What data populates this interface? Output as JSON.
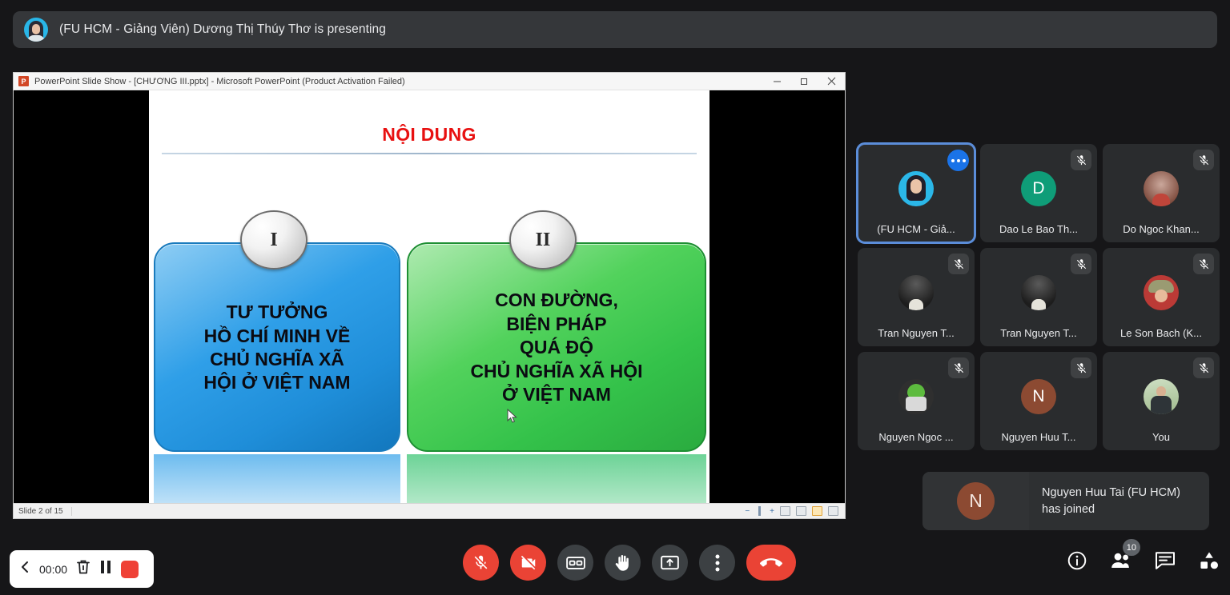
{
  "presenting": {
    "text": "(FU HCM - Giảng Viên) Dương Thị Thúy Thơ is presenting",
    "avatar_icon": "presenter-avatar"
  },
  "powerpoint": {
    "logo_letter": "P",
    "title": "PowerPoint Slide Show - [CHƯƠNG III.pptx] - Microsoft PowerPoint (Product Activation Failed)",
    "window_controls": {
      "minimize": "minimize-icon",
      "restore": "restore-icon",
      "close": "close-icon"
    },
    "status": {
      "slide_counter": "Slide 2 of 15",
      "zoom_out": "−",
      "zoom_in": "+"
    },
    "slide": {
      "title": "NỘI DUNG",
      "topics": [
        {
          "badge": "I",
          "color": "#2f9fe8",
          "lines": [
            "TƯ TƯỞNG",
            "HỒ CHÍ MINH VỀ",
            "CHỦ NGHĨA XÃ",
            "HỘI Ở VIỆT NAM"
          ]
        },
        {
          "badge": "II",
          "color": "#34c24a",
          "lines": [
            "CON ĐƯỜNG,",
            "BIỆN PHÁP",
            "QUÁ ĐỘ",
            "CHỦ NGHĨA XÃ HỘI",
            "Ở VIỆT NAM"
          ]
        }
      ]
    }
  },
  "participants": [
    {
      "name": "(FU HCM - Giả...",
      "avatar_type": "photo-teacher",
      "initial": "",
      "muted": false,
      "selected": true,
      "more_menu": true
    },
    {
      "name": "Dao Le Bao Th...",
      "avatar_type": "initial",
      "initial": "D",
      "avatar_color": "#0f9d78",
      "muted": true,
      "selected": false,
      "more_menu": false
    },
    {
      "name": "Do Ngoc Khan...",
      "avatar_type": "photo-brown",
      "initial": "",
      "muted": true,
      "selected": false,
      "more_menu": false
    },
    {
      "name": "Tran Nguyen T...",
      "avatar_type": "photo-dark",
      "initial": "",
      "muted": true,
      "selected": false,
      "more_menu": false
    },
    {
      "name": "Tran Nguyen T...",
      "avatar_type": "photo-dark",
      "initial": "",
      "muted": true,
      "selected": false,
      "more_menu": false
    },
    {
      "name": "Le Son Bach (K...",
      "avatar_type": "photo-hat",
      "initial": "",
      "muted": true,
      "selected": false,
      "more_menu": false
    },
    {
      "name": "Nguyen Ngoc ...",
      "avatar_type": "photo-frog",
      "initial": "",
      "muted": true,
      "selected": false,
      "more_menu": false
    },
    {
      "name": "Nguyen Huu T...",
      "avatar_type": "initial",
      "initial": "N",
      "avatar_color": "#8c4a32",
      "muted": true,
      "selected": false,
      "more_menu": false
    },
    {
      "name": "You",
      "avatar_type": "photo-outdoor",
      "initial": "",
      "muted": true,
      "selected": false,
      "more_menu": false
    }
  ],
  "toast": {
    "initial": "N",
    "line1": "Nguyen Huu Tai (FU HCM)",
    "line2": "has joined"
  },
  "recording_widget": {
    "back_icon": "chevron-left-icon",
    "time": "00:00",
    "delete_icon": "trash-icon",
    "pause_icon": "pause-icon",
    "stop_icon": "stop-record-icon"
  },
  "call_controls": [
    {
      "name": "microphone-off-button",
      "icon": "mic-off-icon",
      "style": "danger"
    },
    {
      "name": "camera-off-button",
      "icon": "camera-off-icon",
      "style": "danger"
    },
    {
      "name": "captions-button",
      "icon": "closed-caption-icon",
      "style": "neutral"
    },
    {
      "name": "raise-hand-button",
      "icon": "raise-hand-icon",
      "style": "neutral"
    },
    {
      "name": "present-screen-button",
      "icon": "present-screen-icon",
      "style": "neutral"
    },
    {
      "name": "more-options-button",
      "icon": "more-vertical-icon",
      "style": "neutral"
    },
    {
      "name": "end-call-button",
      "icon": "hangup-icon",
      "style": "hangup"
    }
  ],
  "right_icons": [
    {
      "name": "meeting-details-button",
      "icon": "info-icon",
      "badge": ""
    },
    {
      "name": "participants-button",
      "icon": "people-icon",
      "badge": "10"
    },
    {
      "name": "chat-button",
      "icon": "chat-icon",
      "badge": ""
    },
    {
      "name": "activities-button",
      "icon": "activities-icon",
      "badge": ""
    }
  ],
  "colors": {
    "banner": "#35373a",
    "page_background": "#161618",
    "tile_background": "#2a2c2e",
    "selection_blue": "#5b8dd9",
    "danger_red": "#ea4335",
    "slide_title_red": "#e81010"
  }
}
